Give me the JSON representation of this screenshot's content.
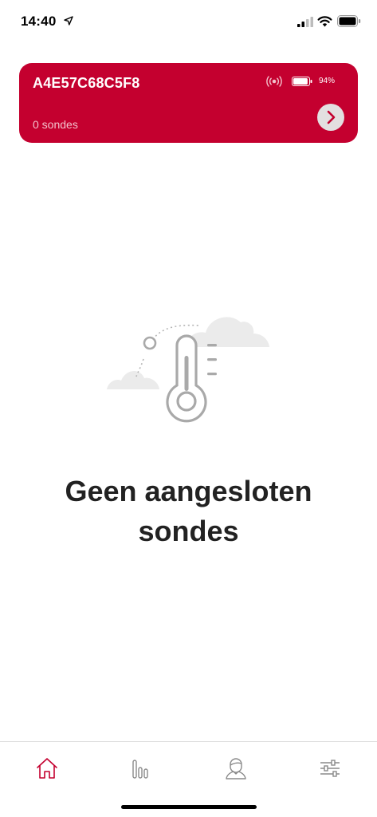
{
  "status_bar": {
    "time": "14:40",
    "icons": [
      "location-arrow-icon",
      "cellular-signal-icon",
      "wifi-icon",
      "battery-icon"
    ]
  },
  "device_card": {
    "device_id": "A4E57C68C5F8",
    "probe_count_label": "0 sondes",
    "battery_percent": "94%",
    "battery_level": 0.94,
    "accent_color": "#c4002f",
    "icons": [
      "connection-broadcast-icon",
      "battery-icon",
      "chevron-right-icon"
    ]
  },
  "empty_state": {
    "illustration": "thermometer-clouds-illustration",
    "title": "Geen aangesloten sondes"
  },
  "tab_bar": {
    "items": [
      {
        "icon": "home-icon",
        "active": true
      },
      {
        "icon": "bar-chart-icon",
        "active": false
      },
      {
        "icon": "profile-icon",
        "active": false
      },
      {
        "icon": "sliders-icon",
        "active": false
      }
    ],
    "active_color": "#c4002f",
    "inactive_color": "#8a8a8a"
  }
}
